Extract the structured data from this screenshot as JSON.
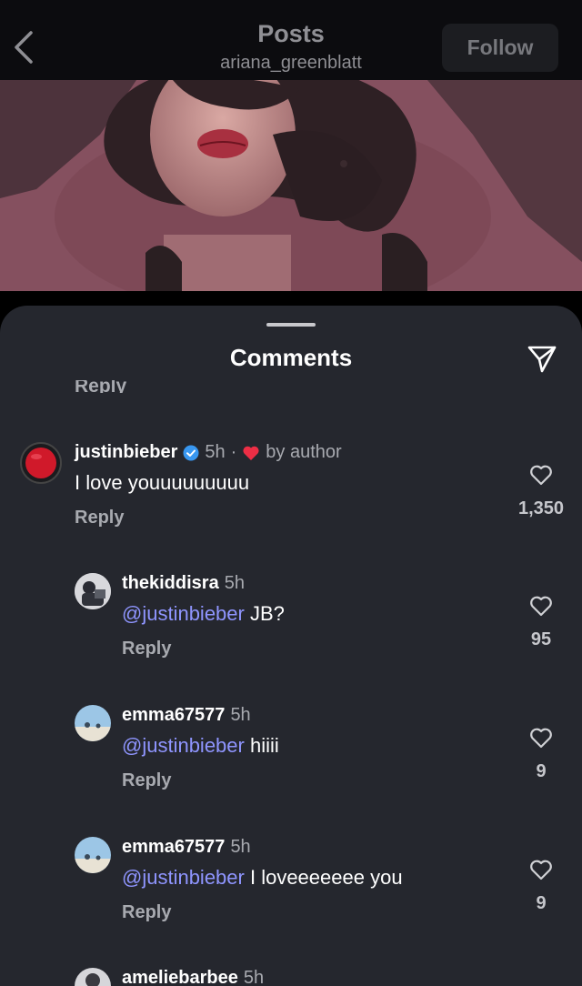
{
  "header": {
    "title": "Posts",
    "subtitle": "ariana_greenblatt",
    "follow_label": "Follow"
  },
  "sheet": {
    "title": "Comments",
    "cut_reply_label": "Reply"
  },
  "comments": [
    {
      "username": "justinbieber",
      "verified": true,
      "time": "5h",
      "by_author": "by author",
      "text": "I love youuuuuuuuu",
      "reply_label": "Reply",
      "likes": "1,350",
      "avatar_color": "#d0192a"
    },
    {
      "username": "thekiddisra",
      "time": "5h",
      "mention": "@justinbieber",
      "text": " JB?",
      "reply_label": "Reply",
      "likes": "95"
    },
    {
      "username": "emma67577",
      "time": "5h",
      "mention": "@justinbieber",
      "text": " hiiii",
      "reply_label": "Reply",
      "likes": "9"
    },
    {
      "username": "emma67577",
      "time": "5h",
      "mention": "@justinbieber",
      "text": " I loveeeeeee you",
      "reply_label": "Reply",
      "likes": "9"
    },
    {
      "username": "ameliebarbee",
      "time": "5h"
    }
  ],
  "colors": {
    "sheet_bg": "#25272e",
    "mention": "#8f95ff",
    "verified": "#3897f0",
    "heart_red": "#ed2e45"
  },
  "icons": [
    "back-arrow-icon",
    "send-icon",
    "verified-icon",
    "heart-icon",
    "heart-outline-icon"
  ]
}
